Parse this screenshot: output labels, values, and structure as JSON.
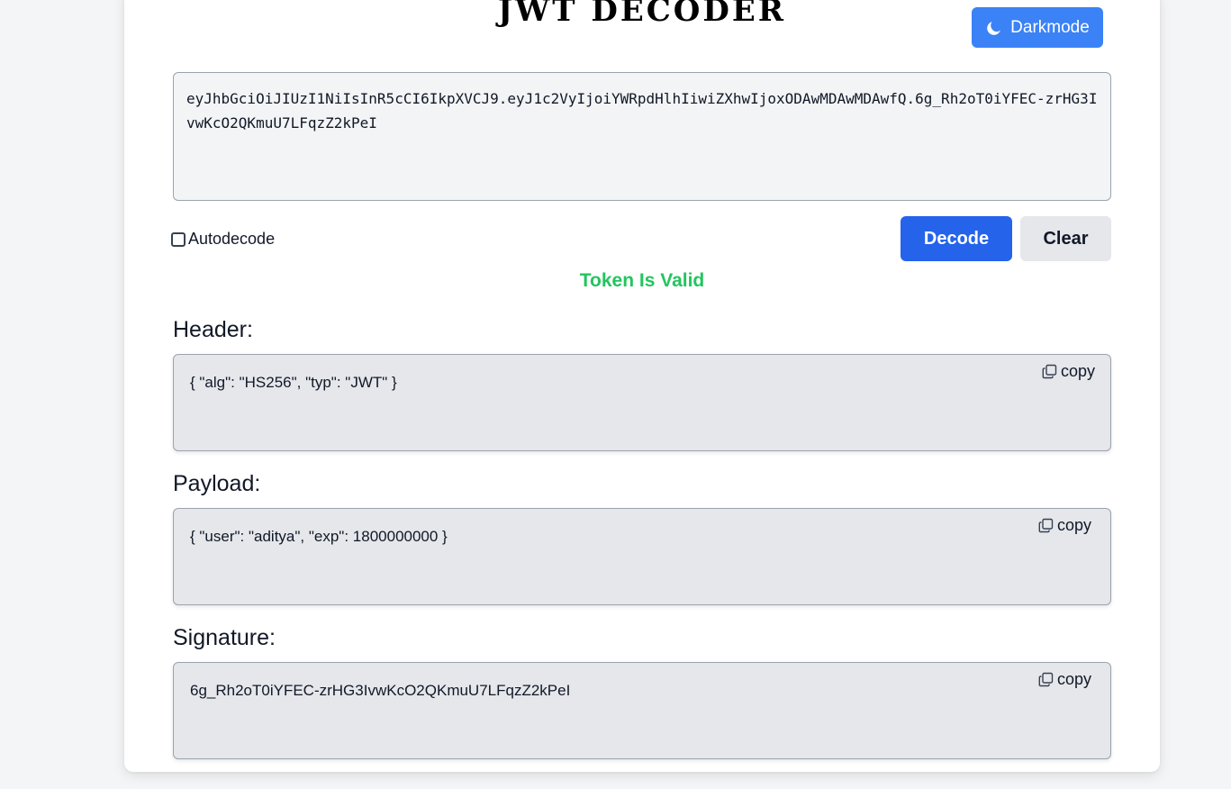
{
  "app": {
    "title": "JWT DECODER",
    "darkmode_label": "Darkmode"
  },
  "token": {
    "value": "eyJhbGciOiJIUzI1NiIsInR5cCI6IkpXVCJ9.eyJ1c2VyIjoiYWRpdHlhIiwiZXhwIjoxODAwMDAwMDAwfQ.6g_Rh2oT0iYFEC-zrHG3IvwKcO2QKmuU7LFqzZ2kPeI"
  },
  "controls": {
    "autodecode_label": "Autodecode",
    "autodecode_checked": false,
    "decode_label": "Decode",
    "clear_label": "Clear"
  },
  "status": {
    "text": "Token Is Valid",
    "color": "#22c55e"
  },
  "sections": {
    "header": {
      "label": "Header:",
      "value": "{ \"alg\": \"HS256\", \"typ\": \"JWT\" }",
      "copy_label": "copy"
    },
    "payload": {
      "label": "Payload:",
      "value": "{ \"user\": \"aditya\", \"exp\": 1800000000 }",
      "copy_label": "copy"
    },
    "signature": {
      "label": "Signature:",
      "value": "6g_Rh2oT0iYFEC-zrHG3IvwKcO2QKmuU7LFqzZ2kPeI",
      "copy_label": "copy"
    }
  },
  "colors": {
    "primary": "#2563eb",
    "darkmode_button": "#3b82f6",
    "output_bg": "#e5e7eb",
    "input_bg": "#f3f4f6"
  },
  "icons": {
    "darkmode": "moon-icon",
    "copy": "copy-icon"
  }
}
